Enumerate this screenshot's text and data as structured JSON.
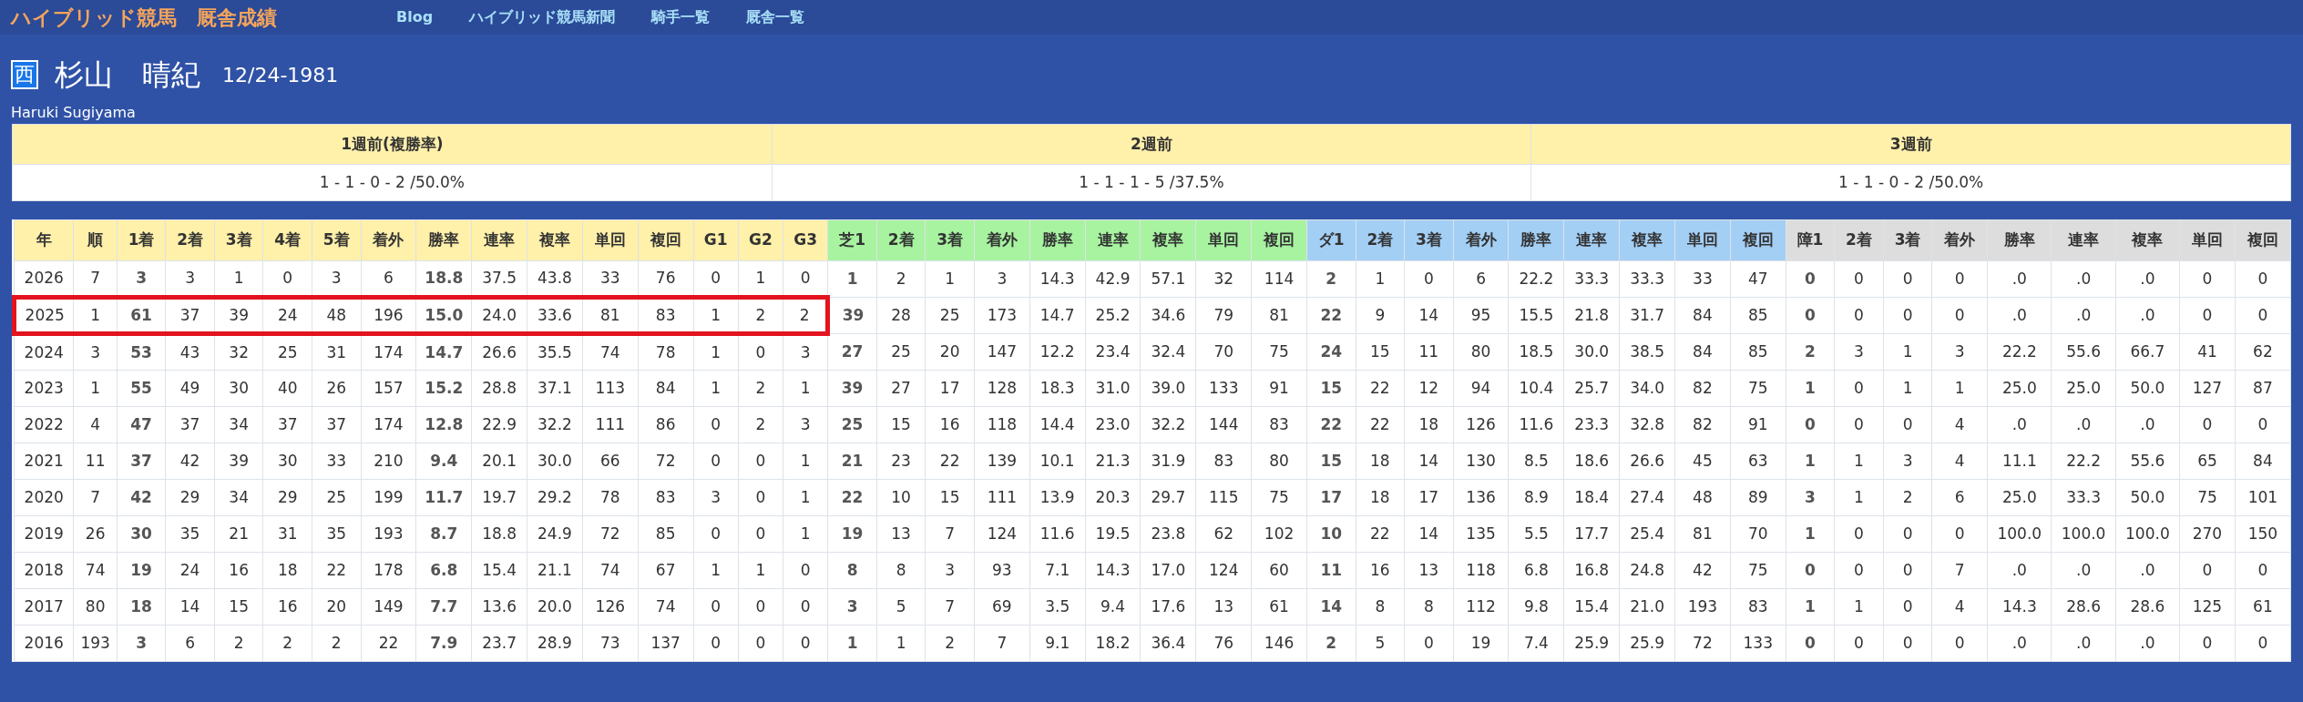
{
  "site_title": "ハイブリッド競馬　厩舎成績",
  "nav": [
    "Blog",
    "ハイブリッド競馬新聞",
    "騎手一覧",
    "厩舎一覧"
  ],
  "profile": {
    "region_badge": "西",
    "name": "杉山　晴紀",
    "birth_date": "12/24-1981",
    "romaji": "Haruki Sugiyama"
  },
  "recent": {
    "columns": [
      "1週前(複勝率)",
      "2週前",
      "3週前"
    ],
    "values": [
      "1 - 1 - 0 - 2 /50.0%",
      "1 - 1 - 1 - 5 /37.5%",
      "1 - 1 - 0 - 2 /50.0%"
    ]
  },
  "table": {
    "columns": [
      {
        "label": "年",
        "kind": "overall",
        "bold": false
      },
      {
        "label": "順",
        "kind": "overall",
        "bold": false
      },
      {
        "label": "1着",
        "kind": "overall",
        "bold": true
      },
      {
        "label": "2着",
        "kind": "overall",
        "bold": false
      },
      {
        "label": "3着",
        "kind": "overall",
        "bold": false
      },
      {
        "label": "4着",
        "kind": "overall",
        "bold": false
      },
      {
        "label": "5着",
        "kind": "overall",
        "bold": false
      },
      {
        "label": "着外",
        "kind": "overall",
        "bold": false
      },
      {
        "label": "勝率",
        "kind": "overall",
        "bold": true
      },
      {
        "label": "連率",
        "kind": "overall",
        "bold": false
      },
      {
        "label": "複率",
        "kind": "overall",
        "bold": false
      },
      {
        "label": "単回",
        "kind": "overall",
        "bold": false
      },
      {
        "label": "複回",
        "kind": "overall",
        "bold": false
      },
      {
        "label": "G1",
        "kind": "overall",
        "bold": false
      },
      {
        "label": "G2",
        "kind": "overall",
        "bold": false
      },
      {
        "label": "G3",
        "kind": "overall",
        "bold": false
      },
      {
        "label": "芝1",
        "kind": "turf",
        "bold": true
      },
      {
        "label": "2着",
        "kind": "turf",
        "bold": false
      },
      {
        "label": "3着",
        "kind": "turf",
        "bold": false
      },
      {
        "label": "着外",
        "kind": "turf",
        "bold": false
      },
      {
        "label": "勝率",
        "kind": "turf",
        "bold": false
      },
      {
        "label": "連率",
        "kind": "turf",
        "bold": false
      },
      {
        "label": "複率",
        "kind": "turf",
        "bold": false
      },
      {
        "label": "単回",
        "kind": "turf",
        "bold": false
      },
      {
        "label": "複回",
        "kind": "turf",
        "bold": false
      },
      {
        "label": "ダ1",
        "kind": "dirt",
        "bold": true
      },
      {
        "label": "2着",
        "kind": "dirt",
        "bold": false
      },
      {
        "label": "3着",
        "kind": "dirt",
        "bold": false
      },
      {
        "label": "着外",
        "kind": "dirt",
        "bold": false
      },
      {
        "label": "勝率",
        "kind": "dirt",
        "bold": false
      },
      {
        "label": "連率",
        "kind": "dirt",
        "bold": false
      },
      {
        "label": "複率",
        "kind": "dirt",
        "bold": false
      },
      {
        "label": "単回",
        "kind": "dirt",
        "bold": false
      },
      {
        "label": "複回",
        "kind": "dirt",
        "bold": false
      },
      {
        "label": "障1",
        "kind": "jump",
        "bold": true
      },
      {
        "label": "2着",
        "kind": "jump",
        "bold": false
      },
      {
        "label": "3着",
        "kind": "jump",
        "bold": false
      },
      {
        "label": "着外",
        "kind": "jump",
        "bold": false
      },
      {
        "label": "勝率",
        "kind": "jump",
        "bold": false
      },
      {
        "label": "連率",
        "kind": "jump",
        "bold": false
      },
      {
        "label": "複率",
        "kind": "jump",
        "bold": false
      },
      {
        "label": "単回",
        "kind": "jump",
        "bold": false
      },
      {
        "label": "複回",
        "kind": "jump",
        "bold": false
      }
    ],
    "rows": [
      {
        "highlighted": false,
        "cells": [
          "2026",
          "7",
          "3",
          "3",
          "1",
          "0",
          "3",
          "6",
          "18.8",
          "37.5",
          "43.8",
          "33",
          "76",
          "0",
          "1",
          "0",
          "1",
          "2",
          "1",
          "3",
          "14.3",
          "42.9",
          "57.1",
          "32",
          "114",
          "2",
          "1",
          "0",
          "6",
          "22.2",
          "33.3",
          "33.3",
          "33",
          "47",
          "0",
          "0",
          "0",
          "0",
          ".0",
          ".0",
          ".0",
          "0",
          "0"
        ]
      },
      {
        "highlighted": true,
        "cells": [
          "2025",
          "1",
          "61",
          "37",
          "39",
          "24",
          "48",
          "196",
          "15.0",
          "24.0",
          "33.6",
          "81",
          "83",
          "1",
          "2",
          "2",
          "39",
          "28",
          "25",
          "173",
          "14.7",
          "25.2",
          "34.6",
          "79",
          "81",
          "22",
          "9",
          "14",
          "95",
          "15.5",
          "21.8",
          "31.7",
          "84",
          "85",
          "0",
          "0",
          "0",
          "0",
          ".0",
          ".0",
          ".0",
          "0",
          "0"
        ]
      },
      {
        "highlighted": false,
        "cells": [
          "2024",
          "3",
          "53",
          "43",
          "32",
          "25",
          "31",
          "174",
          "14.7",
          "26.6",
          "35.5",
          "74",
          "78",
          "1",
          "0",
          "3",
          "27",
          "25",
          "20",
          "147",
          "12.2",
          "23.4",
          "32.4",
          "70",
          "75",
          "24",
          "15",
          "11",
          "80",
          "18.5",
          "30.0",
          "38.5",
          "84",
          "85",
          "2",
          "3",
          "1",
          "3",
          "22.2",
          "55.6",
          "66.7",
          "41",
          "62"
        ]
      },
      {
        "highlighted": false,
        "cells": [
          "2023",
          "1",
          "55",
          "49",
          "30",
          "40",
          "26",
          "157",
          "15.2",
          "28.8",
          "37.1",
          "113",
          "84",
          "1",
          "2",
          "1",
          "39",
          "27",
          "17",
          "128",
          "18.3",
          "31.0",
          "39.0",
          "133",
          "91",
          "15",
          "22",
          "12",
          "94",
          "10.4",
          "25.7",
          "34.0",
          "82",
          "75",
          "1",
          "0",
          "1",
          "1",
          "25.0",
          "25.0",
          "50.0",
          "127",
          "87"
        ]
      },
      {
        "highlighted": false,
        "cells": [
          "2022",
          "4",
          "47",
          "37",
          "34",
          "37",
          "37",
          "174",
          "12.8",
          "22.9",
          "32.2",
          "111",
          "86",
          "0",
          "2",
          "3",
          "25",
          "15",
          "16",
          "118",
          "14.4",
          "23.0",
          "32.2",
          "144",
          "83",
          "22",
          "22",
          "18",
          "126",
          "11.6",
          "23.3",
          "32.8",
          "82",
          "91",
          "0",
          "0",
          "0",
          "4",
          ".0",
          ".0",
          ".0",
          "0",
          "0"
        ]
      },
      {
        "highlighted": false,
        "cells": [
          "2021",
          "11",
          "37",
          "42",
          "39",
          "30",
          "33",
          "210",
          "9.4",
          "20.1",
          "30.0",
          "66",
          "72",
          "0",
          "0",
          "1",
          "21",
          "23",
          "22",
          "139",
          "10.1",
          "21.3",
          "31.9",
          "83",
          "80",
          "15",
          "18",
          "14",
          "130",
          "8.5",
          "18.6",
          "26.6",
          "45",
          "63",
          "1",
          "1",
          "3",
          "4",
          "11.1",
          "22.2",
          "55.6",
          "65",
          "84"
        ]
      },
      {
        "highlighted": false,
        "cells": [
          "2020",
          "7",
          "42",
          "29",
          "34",
          "29",
          "25",
          "199",
          "11.7",
          "19.7",
          "29.2",
          "78",
          "83",
          "3",
          "0",
          "1",
          "22",
          "10",
          "15",
          "111",
          "13.9",
          "20.3",
          "29.7",
          "115",
          "75",
          "17",
          "18",
          "17",
          "136",
          "8.9",
          "18.4",
          "27.4",
          "48",
          "89",
          "3",
          "1",
          "2",
          "6",
          "25.0",
          "33.3",
          "50.0",
          "75",
          "101"
        ]
      },
      {
        "highlighted": false,
        "cells": [
          "2019",
          "26",
          "30",
          "35",
          "21",
          "31",
          "35",
          "193",
          "8.7",
          "18.8",
          "24.9",
          "72",
          "85",
          "0",
          "0",
          "1",
          "19",
          "13",
          "7",
          "124",
          "11.6",
          "19.5",
          "23.8",
          "62",
          "102",
          "10",
          "22",
          "14",
          "135",
          "5.5",
          "17.7",
          "25.4",
          "81",
          "70",
          "1",
          "0",
          "0",
          "0",
          "100.0",
          "100.0",
          "100.0",
          "270",
          "150"
        ]
      },
      {
        "highlighted": false,
        "cells": [
          "2018",
          "74",
          "19",
          "24",
          "16",
          "18",
          "22",
          "178",
          "6.8",
          "15.4",
          "21.1",
          "74",
          "67",
          "1",
          "1",
          "0",
          "8",
          "8",
          "3",
          "93",
          "7.1",
          "14.3",
          "17.0",
          "124",
          "60",
          "11",
          "16",
          "13",
          "118",
          "6.8",
          "16.8",
          "24.8",
          "42",
          "75",
          "0",
          "0",
          "0",
          "7",
          ".0",
          ".0",
          ".0",
          "0",
          "0"
        ]
      },
      {
        "highlighted": false,
        "cells": [
          "2017",
          "80",
          "18",
          "14",
          "15",
          "16",
          "20",
          "149",
          "7.7",
          "13.6",
          "20.0",
          "126",
          "74",
          "0",
          "0",
          "0",
          "3",
          "5",
          "7",
          "69",
          "3.5",
          "9.4",
          "17.6",
          "13",
          "61",
          "14",
          "8",
          "8",
          "112",
          "9.8",
          "15.4",
          "21.0",
          "193",
          "83",
          "1",
          "1",
          "0",
          "4",
          "14.3",
          "28.6",
          "28.6",
          "125",
          "61"
        ]
      },
      {
        "highlighted": false,
        "cells": [
          "2016",
          "193",
          "3",
          "6",
          "2",
          "2",
          "2",
          "22",
          "7.9",
          "23.7",
          "28.9",
          "73",
          "137",
          "0",
          "0",
          "0",
          "1",
          "1",
          "2",
          "7",
          "9.1",
          "18.2",
          "36.4",
          "76",
          "146",
          "2",
          "5",
          "0",
          "19",
          "7.4",
          "25.9",
          "25.9",
          "72",
          "133",
          "0",
          "0",
          "0",
          "0",
          ".0",
          ".0",
          ".0",
          "0",
          "0"
        ]
      }
    ]
  }
}
